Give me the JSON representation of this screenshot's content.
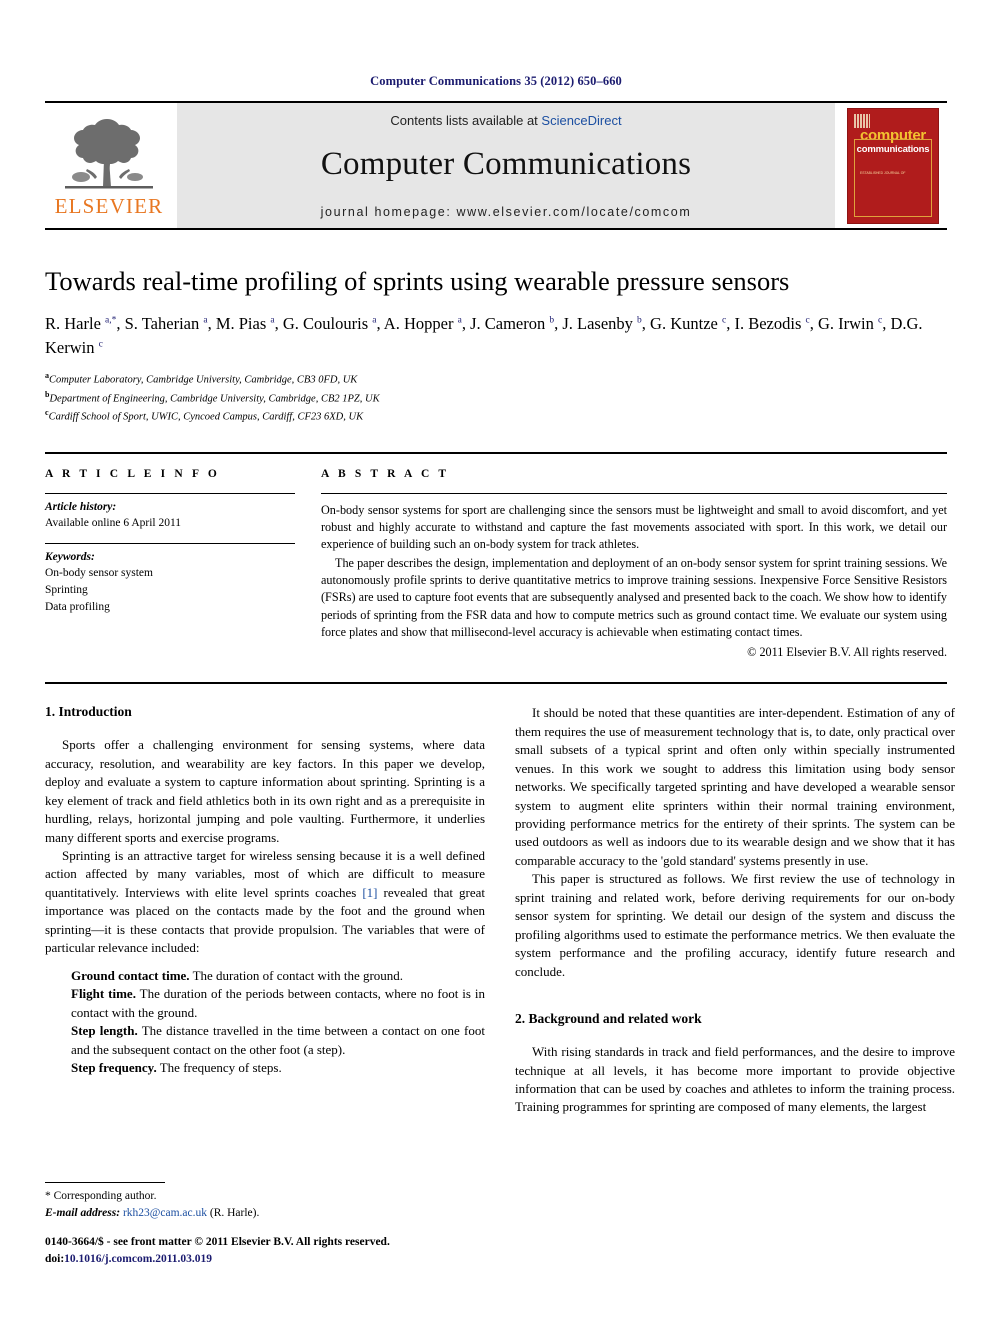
{
  "running_head": "Computer Communications 35 (2012) 650–660",
  "masthead": {
    "publisher_name": "ELSEVIER",
    "contents_prefix": "Contents lists available at ",
    "sciencedirect": "ScienceDirect",
    "journal_title": "Computer Communications",
    "homepage": "journal homepage: www.elsevier.com/locate/comcom",
    "cover": {
      "line1": "computer",
      "line2": "communications",
      "sub": "ESTABLISHED JOURNAL OF"
    }
  },
  "article": {
    "title": "Towards real-time profiling of sprints using wearable pressure sensors",
    "authors_html": "R. Harle <sup>a,*</sup>, S. Taherian <sup>a</sup>, M. Pias <sup>a</sup>, G. Coulouris <sup>a</sup>, A. Hopper <sup>a</sup>, J. Cameron <sup>b</sup>, J. Lasenby <sup>b</sup>, G. Kuntze <sup>c</sup>, I. Bezodis <sup>c</sup>, G. Irwin <sup>c</sup>, D.G. Kerwin <sup>c</sup>",
    "affiliations": [
      {
        "mark": "a",
        "text": "Computer Laboratory, Cambridge University, Cambridge, CB3 0FD, UK"
      },
      {
        "mark": "b",
        "text": "Department of Engineering, Cambridge University, Cambridge, CB2 1PZ, UK"
      },
      {
        "mark": "c",
        "text": "Cardiff School of Sport, UWIC, Cyncoed Campus, Cardiff, CF23 6XD, UK"
      }
    ]
  },
  "article_info": {
    "label": "A R T I C L E   I N F O",
    "history_head": "Article history:",
    "history_line": "Available online 6 April 2011",
    "keywords_head": "Keywords:",
    "keywords": [
      "On-body sensor system",
      "Sprinting",
      "Data profiling"
    ]
  },
  "abstract": {
    "label": "A B S T R A C T",
    "paragraphs": [
      "On-body sensor systems for sport are challenging since the sensors must be lightweight and small to avoid discomfort, and yet robust and highly accurate to withstand and capture the fast movements associated with sport. In this work, we detail our experience of building such an on-body system for track athletes.",
      "The paper describes the design, implementation and deployment of an on-body sensor system for sprint training sessions. We autonomously profile sprints to derive quantitative metrics to improve training sessions. Inexpensive Force Sensitive Resistors (FSRs) are used to capture foot events that are subsequently analysed and presented back to the coach. We show how to identify periods of sprinting from the FSR data and how to compute metrics such as ground contact time. We evaluate our system using force plates and show that millisecond-level accuracy is achievable when estimating contact times."
    ],
    "copyright": "© 2011 Elsevier B.V. All rights reserved."
  },
  "body": {
    "section1_heading": "1. Introduction",
    "section1_paragraphs": [
      "Sports offer a challenging environment for sensing systems, where data accuracy, resolution, and wearability are key factors. In this paper we develop, deploy and evaluate a system to capture information about sprinting. Sprinting is a key element of track and field athletics both in its own right and as a prerequisite in hurdling, relays, horizontal jumping and pole vaulting. Furthermore, it underlies many different sports and exercise programs."
    ],
    "section1_paragraph2_pre": "Sprinting is an attractive target for wireless sensing because it is a well defined action affected by many variables, most of which are difficult to measure quantitatively. Interviews with elite level sprints coaches ",
    "section1_paragraph2_cite": "[1]",
    "section1_paragraph2_post": " revealed that great importance was placed on the contacts made by the foot and the ground when sprinting—it is these contacts that provide propulsion. The variables that were of particular relevance included:",
    "variables": [
      {
        "term": "Ground contact time.",
        "definition": " The duration of contact with the ground."
      },
      {
        "term": "Flight time.",
        "definition": " The duration of the periods between contacts, where no foot is in contact with the ground."
      },
      {
        "term": "Step length.",
        "definition": " The distance travelled in the time between a contact on one foot and the subsequent contact on the other foot (a step)."
      },
      {
        "term": "Step frequency.",
        "definition": " The frequency of steps."
      }
    ],
    "right_paragraphs": [
      "It should be noted that these quantities are inter-dependent. Estimation of any of them requires the use of measurement technology that is, to date, only practical over small subsets of a typical sprint and often only within specially instrumented venues. In this work we sought to address this limitation using body sensor networks. We specifically targeted sprinting and have developed a wearable sensor system to augment elite sprinters within their normal training environment, providing performance metrics for the entirety of their sprints. The system can be used outdoors as well as indoors due to its wearable design and we show that it has comparable accuracy to the 'gold standard' systems presently in use.",
      "This paper is structured as follows. We first review the use of technology in sprint training and related work, before deriving requirements for our on-body sensor system for sprinting. We detail our design of the system and discuss the profiling algorithms used to estimate the performance metrics. We then evaluate the system performance and the profiling accuracy, identify future research and conclude."
    ],
    "section2_heading": "2. Background and related work",
    "section2_paragraphs": [
      "With rising standards in track and field performances, and the desire to improve technique at all levels, it has become more important to provide objective information that can be used by coaches and athletes to inform the training process. Training programmes for sprinting are composed of many elements, the largest"
    ]
  },
  "footnote": {
    "corresponding": "* Corresponding author.",
    "email_label": "E-mail address:",
    "email": "rkh23@cam.ac.uk",
    "email_suffix": " (R. Harle)."
  },
  "bottom": {
    "issn_line": "0140-3664/$ - see front matter © 2011 Elsevier B.V. All rights reserved.",
    "doi_label": "doi:",
    "doi_value": "10.1016/j.comcom.2011.03.019"
  },
  "colors": {
    "link_blue": "#1c4fa1",
    "head_navy": "#1b1b6f",
    "elsevier_orange": "#E87722",
    "cover_red": "#b01c1c"
  }
}
